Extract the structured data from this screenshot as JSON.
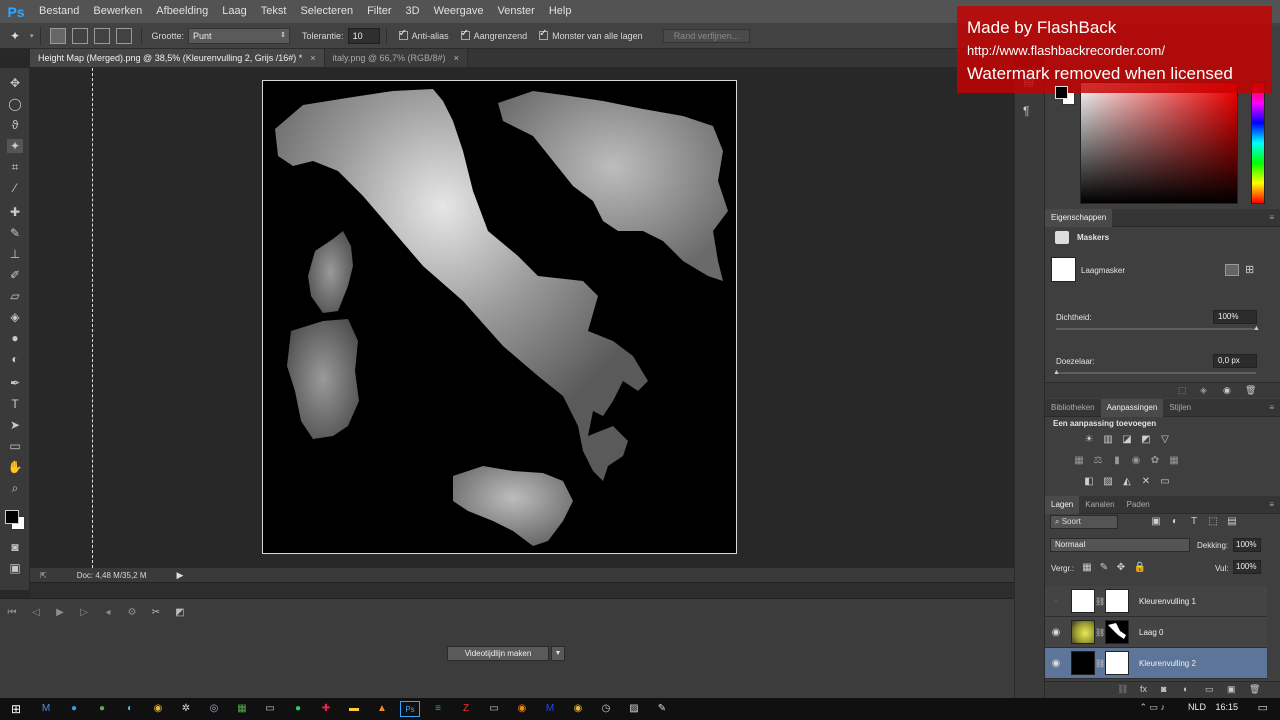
{
  "app": {
    "logo": "Ps",
    "menu": [
      "Bestand",
      "Bewerken",
      "Afbeelding",
      "Laag",
      "Tekst",
      "Selecteren",
      "Filter",
      "3D",
      "Weergave",
      "Venster",
      "Help"
    ]
  },
  "options": {
    "grootte_label": "Grootte:",
    "grootte_value": "Punt",
    "tolerantie_label": "Tolerantie:",
    "tolerantie_value": "10",
    "anti_alias": "Anti-alias",
    "aangrenzend": "Aangrenzend",
    "monster": "Monster van alle lagen",
    "rand_verfijnen": "Rand verfijnen..."
  },
  "tabs": [
    {
      "label": "Height Map (Merged).png @ 38,5% (Kleurenvulling 2, Grijs /16#) *",
      "active": true
    },
    {
      "label": "italy.png @ 66,7% (RGB/8#)",
      "active": false
    }
  ],
  "status": {
    "doc": "Doc: 4,48 M/35,2 M"
  },
  "timeline": {
    "create_label": "Videotijdlijn maken"
  },
  "watermark": {
    "line1": "Made by FlashBack",
    "line2": "http://www.flashbackrecorder.com/",
    "line3": "Watermark removed when licensed"
  },
  "properties": {
    "tab": "Eigenschappen",
    "section": "Maskers",
    "mask_label": "Laagmasker",
    "dichtheid_label": "Dichtheid:",
    "dichtheid_value": "100%",
    "doezelaar_label": "Doezelaar:",
    "doezelaar_value": "0,0 px",
    "dichtheid_level": 1.0,
    "doezelaar_level": 0.0
  },
  "adjustments": {
    "tabs": [
      "Bibliotheken",
      "Aanpassingen",
      "Stijlen"
    ],
    "active_tab": "Aanpassingen",
    "title": "Een aanpassing toevoegen"
  },
  "layers": {
    "tabs": [
      "Lagen",
      "Kanalen",
      "Paden"
    ],
    "filter_label": "Soort",
    "blend_mode": "Normaal",
    "dekking_label": "Dekking:",
    "dekking_value": "100%",
    "vergr_label": "Vergr.:",
    "vul_label": "Vul:",
    "vul_value": "100%",
    "items": [
      {
        "name": "Kleurenvulling 1",
        "visible": false,
        "selected": false
      },
      {
        "name": "Laag 0",
        "visible": true,
        "selected": false
      },
      {
        "name": "Kleurenvulling 2",
        "visible": true,
        "selected": true
      }
    ]
  },
  "taskbar": {
    "lang": "NLD",
    "time": "16:15"
  },
  "colors": {
    "selection": "#5d7598",
    "watermark": "#c80000",
    "ps_blue": "#31a8ff"
  }
}
